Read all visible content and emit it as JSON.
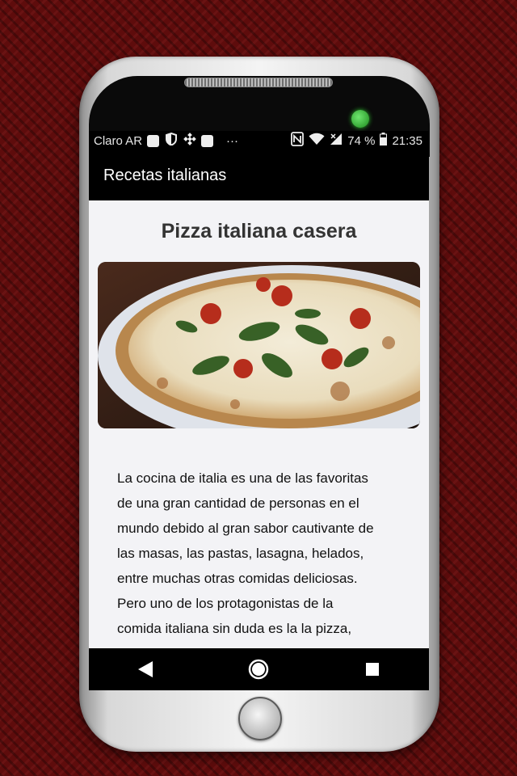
{
  "status_bar": {
    "carrier": "Claro AR",
    "battery": "74 %",
    "time": "21:35"
  },
  "app_bar": {
    "title": "Recetas italianas"
  },
  "recipe": {
    "title": "Pizza italiana casera",
    "image_alt_icon": "pizza-photo",
    "lines": [
      "La cocina de italia es una de las favoritas",
      "de una gran cantidad de personas en el",
      "mundo debido al gran sabor cautivante de",
      "las masas, las pastas, lasagna, helados,",
      "entre muchas otras comidas deliciosas.",
      "Pero uno de los protagonistas de la",
      "comida italiana sin duda es la la pizza,"
    ]
  },
  "nav": {
    "back_icon": "back-icon",
    "home_icon": "home-circle-icon",
    "recents_icon": "recents-icon"
  },
  "colors": {
    "background": "#5e0c0c",
    "appbar": "#000000",
    "content_bg": "#f3f3f6"
  }
}
